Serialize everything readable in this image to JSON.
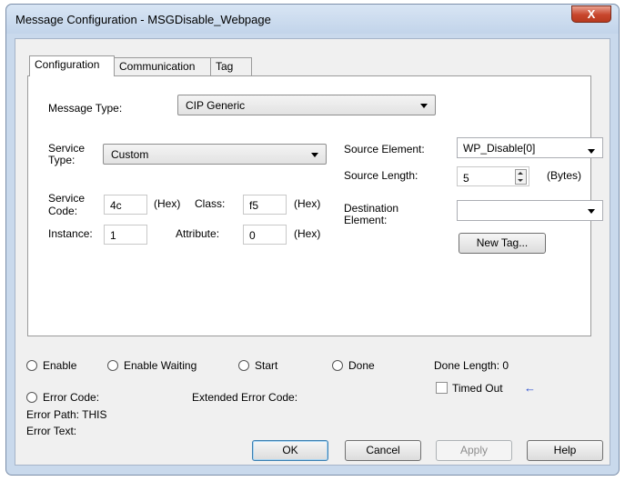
{
  "window": {
    "title": "Message Configuration - MSGDisable_Webpage",
    "close_label": "X"
  },
  "tabs": [
    {
      "label": "Configuration"
    },
    {
      "label": "Communication"
    },
    {
      "label": "Tag"
    }
  ],
  "config": {
    "message_type_label": "Message Type:",
    "message_type_value": "CIP Generic",
    "service_type_label_1": "Service",
    "service_type_label_2": "Type:",
    "service_type_value": "Custom",
    "service_code_label_1": "Service",
    "service_code_label_2": "Code:",
    "service_code_value": "4c",
    "hex_label": "(Hex)",
    "class_label": "Class:",
    "class_value": "f5",
    "instance_label": "Instance:",
    "instance_value": "1",
    "attribute_label": "Attribute:",
    "attribute_value": "0",
    "source_element_label": "Source Element:",
    "source_element_value": "WP_Disable[0]",
    "source_length_label": "Source Length:",
    "source_length_value": "5",
    "bytes_label": "(Bytes)",
    "destination_label_1": "Destination",
    "destination_label_2": "Element:",
    "destination_value": "",
    "new_tag_label": "New Tag..."
  },
  "status": {
    "enable": "Enable",
    "enable_waiting": "Enable Waiting",
    "start": "Start",
    "done": "Done",
    "done_length": "Done Length: 0",
    "error_code": "Error Code:",
    "extended_error_code": "Extended Error Code:",
    "timed_out": "Timed Out",
    "error_path": "Error Path: THIS",
    "error_text": "Error Text:"
  },
  "buttons": {
    "ok": "OK",
    "cancel": "Cancel",
    "apply": "Apply",
    "help": "Help"
  },
  "colors": {
    "title_bar": "#c9d9ec",
    "close_button": "#c7462c",
    "timed_out_arrow": "#2a4fcf"
  }
}
